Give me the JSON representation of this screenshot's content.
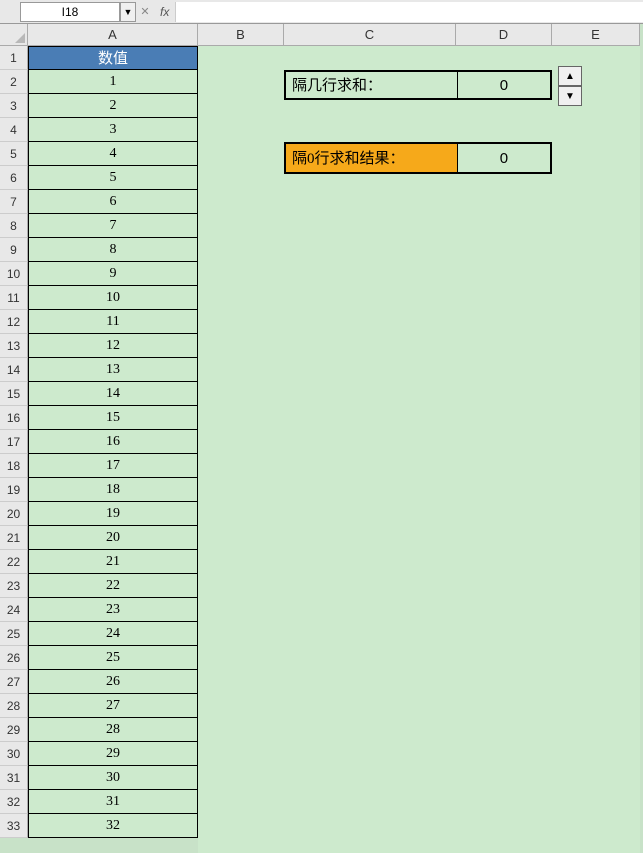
{
  "formula_bar": {
    "cell_ref": "I18",
    "fx_label": "fx",
    "formula_value": ""
  },
  "columns": [
    "A",
    "B",
    "C",
    "D",
    "E"
  ],
  "rows": [
    "1",
    "2",
    "3",
    "4",
    "5",
    "6",
    "7",
    "8",
    "9",
    "10",
    "11",
    "12",
    "13",
    "14",
    "15",
    "16",
    "17",
    "18",
    "19",
    "20",
    "21",
    "22",
    "23",
    "24",
    "25",
    "26",
    "27",
    "28",
    "29",
    "30",
    "31",
    "32",
    "33"
  ],
  "columnA": {
    "header": "数值",
    "values": [
      "1",
      "2",
      "3",
      "4",
      "5",
      "6",
      "7",
      "8",
      "9",
      "10",
      "11",
      "12",
      "13",
      "14",
      "15",
      "16",
      "17",
      "18",
      "19",
      "20",
      "21",
      "22",
      "23",
      "24",
      "25",
      "26",
      "27",
      "28",
      "29",
      "30",
      "31",
      "32"
    ]
  },
  "box1": {
    "label": "隔几行求和：",
    "value": "0"
  },
  "box2": {
    "label": "隔0行求和结果：",
    "value": "0"
  },
  "spinner_icons": {
    "up": "▲",
    "down": "▼"
  }
}
